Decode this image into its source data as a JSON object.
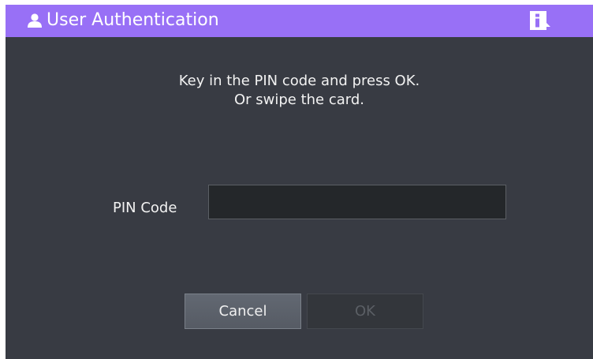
{
  "header": {
    "title": "User Authentication",
    "user_icon": "user-icon",
    "info_icon": "info-icon",
    "background_color": "#9870f6"
  },
  "prompt": {
    "line1": "Key in the PIN code and press OK.",
    "line2": "Or swipe the card."
  },
  "pin": {
    "label": "PIN Code",
    "value": ""
  },
  "buttons": {
    "cancel_label": "Cancel",
    "ok_label": "OK",
    "ok_enabled": false
  },
  "colors": {
    "window_background": "#383b43",
    "text": "#f2f2f2"
  }
}
